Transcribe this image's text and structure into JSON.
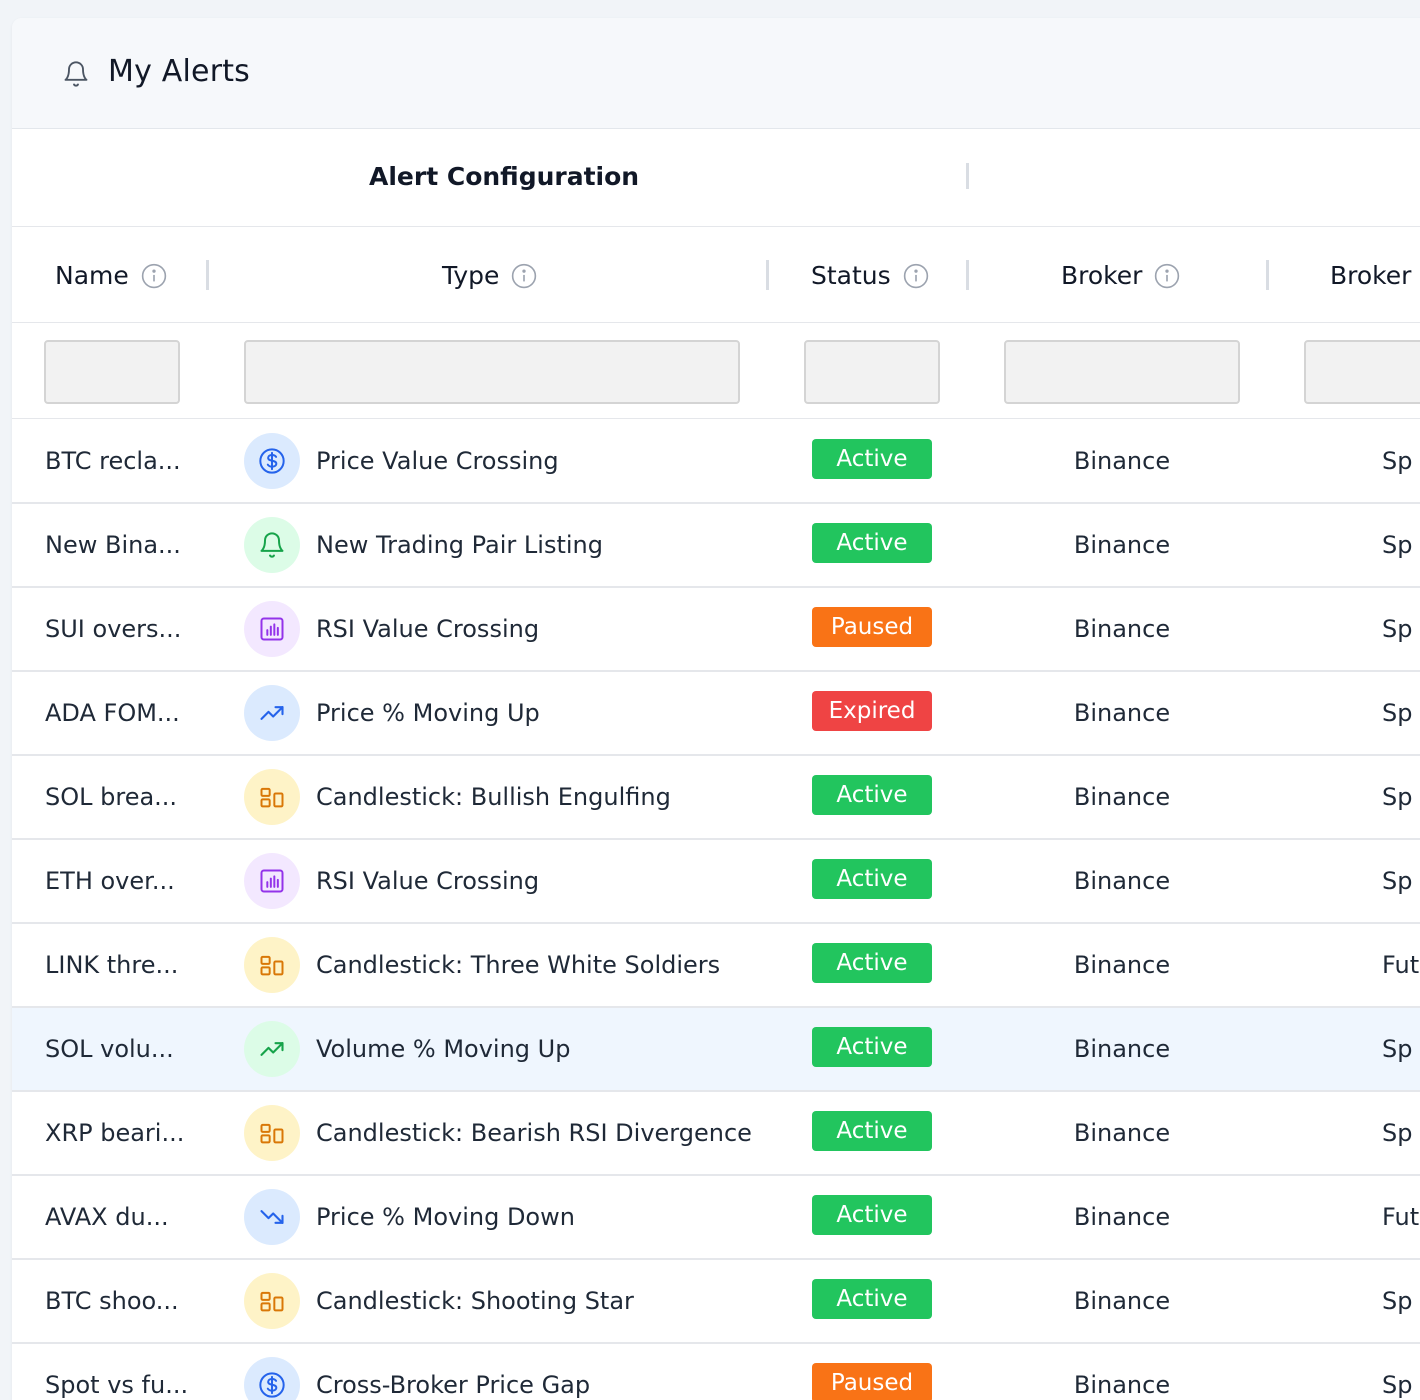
{
  "page": {
    "title": "My Alerts",
    "icon": "bell-icon"
  },
  "group_header": {
    "title": "Alert Configuration"
  },
  "columns": {
    "name": "Name",
    "type": "Type",
    "status": "Status",
    "broker": "Broker",
    "broker_type": "Broker t"
  },
  "filters": {
    "name": "",
    "type": "",
    "status": "",
    "broker": "",
    "broker_type": ""
  },
  "colors": {
    "active": "#22c55e",
    "paused": "#f97316",
    "expired": "#ef4444",
    "highlight_row": "#eff6fe"
  },
  "rows": [
    {
      "name": "BTC recla...",
      "type": "Price Value Crossing",
      "icon": "dollar-icon",
      "status": "Active",
      "broker": "Binance",
      "broker_type": "Sp"
    },
    {
      "name": "New Bina...",
      "type": "New Trading Pair Listing",
      "icon": "bell-icon",
      "status": "Active",
      "broker": "Binance",
      "broker_type": "Sp"
    },
    {
      "name": "SUI overs...",
      "type": "RSI Value Crossing",
      "icon": "bar-chart-icon",
      "status": "Paused",
      "broker": "Binance",
      "broker_type": "Sp"
    },
    {
      "name": "ADA FOM...",
      "type": "Price % Moving Up",
      "icon": "trending-up-icon",
      "status": "Expired",
      "broker": "Binance",
      "broker_type": "Sp"
    },
    {
      "name": "SOL brea...",
      "type": "Candlestick: Bullish Engulfing",
      "icon": "candlestick-icon",
      "status": "Active",
      "broker": "Binance",
      "broker_type": "Sp"
    },
    {
      "name": "ETH over...",
      "type": "RSI Value Crossing",
      "icon": "bar-chart-icon",
      "status": "Active",
      "broker": "Binance",
      "broker_type": "Sp"
    },
    {
      "name": "LINK thre...",
      "type": "Candlestick: Three White Soldiers",
      "icon": "candlestick-icon",
      "status": "Active",
      "broker": "Binance",
      "broker_type": "Futu"
    },
    {
      "name": "SOL volu...",
      "type": "Volume % Moving Up",
      "icon": "volume-up-icon",
      "status": "Active",
      "broker": "Binance",
      "broker_type": "Sp",
      "highlighted": true
    },
    {
      "name": "XRP beari...",
      "type": "Candlestick: Bearish RSI Divergence",
      "icon": "candlestick-icon",
      "status": "Active",
      "broker": "Binance",
      "broker_type": "Sp"
    },
    {
      "name": "AVAX du...",
      "type": "Price % Moving Down",
      "icon": "trending-down-icon",
      "status": "Active",
      "broker": "Binance",
      "broker_type": "Futu"
    },
    {
      "name": "BTC shoo...",
      "type": "Candlestick: Shooting Star",
      "icon": "candlestick-icon",
      "status": "Active",
      "broker": "Binance",
      "broker_type": "Sp"
    },
    {
      "name": "Spot vs fu...",
      "type": "Cross-Broker Price Gap",
      "icon": "dollar-icon",
      "status": "Paused",
      "broker": "Binance",
      "broker_type": "Sp"
    }
  ]
}
